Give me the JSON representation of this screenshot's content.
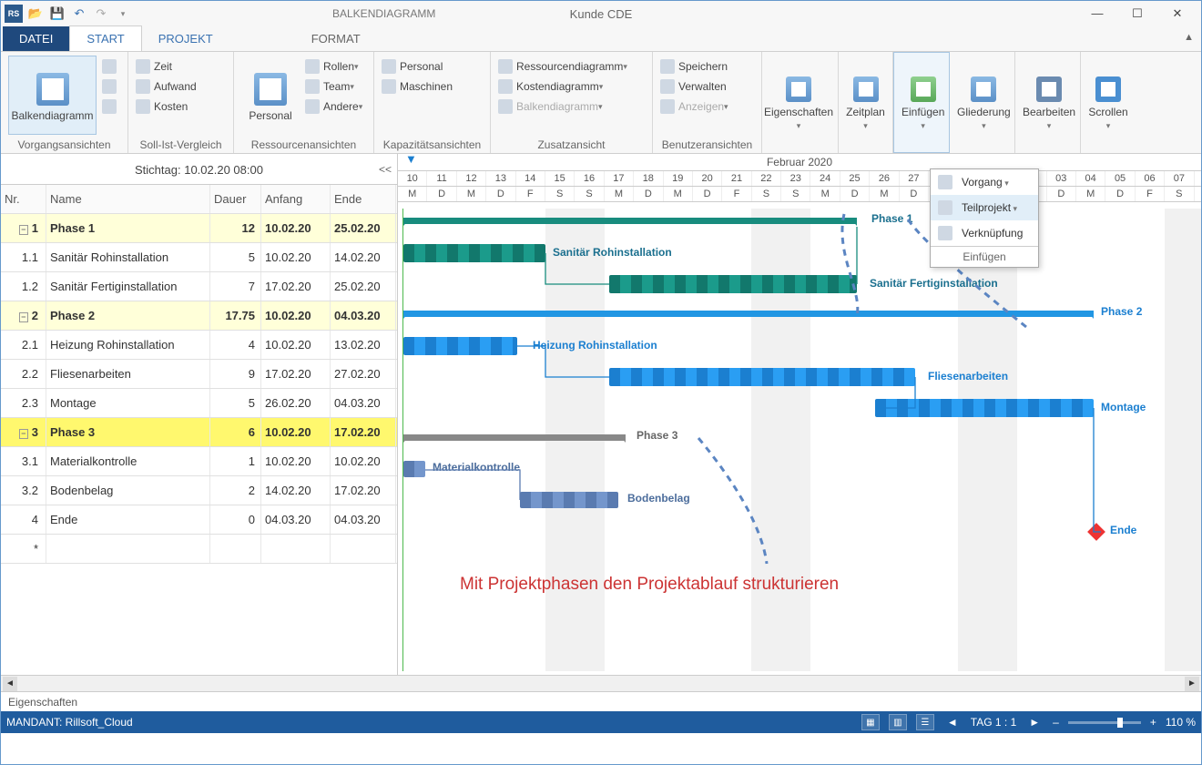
{
  "titlebar": {
    "title": "Kunde CDE",
    "contextual": "BALKENDIAGRAMM"
  },
  "tabs": {
    "file": "DATEI",
    "start": "START",
    "projekt": "PROJEKT",
    "format": "FORMAT"
  },
  "ribbon": {
    "g1": {
      "label": "Vorgangsansichten",
      "balken": "Balkendiagramm"
    },
    "g2": {
      "label": "Soll-Ist-Vergleich",
      "zeit": "Zeit",
      "aufwand": "Aufwand",
      "kosten": "Kosten"
    },
    "g3": {
      "label": "Ressourcenansichten",
      "personal": "Personal",
      "rollen": "Rollen",
      "team": "Team",
      "andere": "Andere"
    },
    "g4": {
      "label": "Kapazitätsansichten",
      "personal": "Personal",
      "maschinen": "Maschinen"
    },
    "g5": {
      "label": "Zusatzansicht",
      "res": "Ressourcendiagramm",
      "kost": "Kostendiagramm",
      "balk": "Balkendiagramm"
    },
    "g6": {
      "label": "Benutzeransichten",
      "speichern": "Speichern",
      "verwalten": "Verwalten",
      "anzeigen": "Anzeigen"
    },
    "g7": "Eigenschaften",
    "g8": "Zeitplan",
    "g9": "Einfügen",
    "g10": "Gliederung",
    "g11": "Bearbeiten",
    "g12": "Scrollen"
  },
  "dropdown": {
    "vorgang": "Vorgang",
    "teilprojekt": "Teilprojekt",
    "verknuepfung": "Verknüpfung",
    "footer": "Einfügen"
  },
  "leftpane": {
    "stichtag": "Stichtag: 10.02.20 08:00",
    "collapse": "<<",
    "headers": {
      "nr": "Nr.",
      "name": "Name",
      "dauer": "Dauer",
      "anfang": "Anfang",
      "ende": "Ende"
    },
    "rows": [
      {
        "nr": "1",
        "name": "Phase 1",
        "d": "12",
        "a": "10.02.20",
        "e": "25.02.20",
        "type": "phase"
      },
      {
        "nr": "1.1",
        "name": "Sanitär Rohinstallation",
        "d": "5",
        "a": "10.02.20",
        "e": "14.02.20",
        "type": "task"
      },
      {
        "nr": "1.2",
        "name": "Sanitär Fertiginstallation",
        "d": "7",
        "a": "17.02.20",
        "e": "25.02.20",
        "type": "task"
      },
      {
        "nr": "2",
        "name": "Phase 2",
        "d": "17.75",
        "a": "10.02.20",
        "e": "04.03.20",
        "type": "phase"
      },
      {
        "nr": "2.1",
        "name": "Heizung Rohinstallation",
        "d": "4",
        "a": "10.02.20",
        "e": "13.02.20",
        "type": "task"
      },
      {
        "nr": "2.2",
        "name": "Fliesenarbeiten",
        "d": "9",
        "a": "17.02.20",
        "e": "27.02.20",
        "type": "task"
      },
      {
        "nr": "2.3",
        "name": "Montage",
        "d": "5",
        "a": "26.02.20",
        "e": "04.03.20",
        "type": "task"
      },
      {
        "nr": "3",
        "name": "Phase 3",
        "d": "6",
        "a": "10.02.20",
        "e": "17.02.20",
        "type": "selphase"
      },
      {
        "nr": "3.1",
        "name": "Materialkontrolle",
        "d": "1",
        "a": "10.02.20",
        "e": "10.02.20",
        "type": "task"
      },
      {
        "nr": "3.2",
        "name": "Bodenbelag",
        "d": "2",
        "a": "14.02.20",
        "e": "17.02.20",
        "type": "task"
      },
      {
        "nr": "4",
        "name": "Ende",
        "d": "0",
        "a": "04.03.20",
        "e": "04.03.20",
        "type": "task"
      },
      {
        "nr": "*",
        "name": "",
        "d": "",
        "a": "",
        "e": "",
        "type": "task"
      }
    ]
  },
  "timeline": {
    "month": "Februar 2020",
    "firstDay": 10,
    "lastDay": 36,
    "barLabels": {
      "p1": "Phase 1",
      "s1": "Sanitär Rohinstallation",
      "s2": "Sanitär Fertiginstallation",
      "p2": "Phase 2",
      "h1": "Heizung Rohinstallation",
      "fl": "Fliesenarbeiten",
      "mo": "Montage",
      "p3": "Phase 3",
      "mk": "Materialkontrolle",
      "bb": "Bodenbelag",
      "end": "Ende"
    }
  },
  "annotation": "Mit Projektphasen den Projektablauf strukturieren",
  "bottom": {
    "eigenschaften": "Eigenschaften",
    "mandant": "MANDANT: Rillsoft_Cloud",
    "scale": "TAG 1 : 1",
    "zoom": "110 %"
  }
}
